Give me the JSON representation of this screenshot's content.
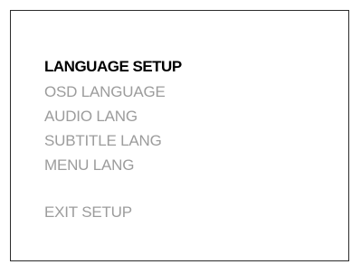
{
  "menu": {
    "title": "LANGUAGE SETUP",
    "items": [
      {
        "label": "OSD LANGUAGE"
      },
      {
        "label": "AUDIO LANG"
      },
      {
        "label": "SUBTITLE LANG"
      },
      {
        "label": "MENU LANG"
      }
    ],
    "exit_label": "EXIT SETUP"
  },
  "colors": {
    "title": "#000000",
    "item": "#9c9c9c",
    "border": "#2b2b2b",
    "background": "#ffffff"
  }
}
